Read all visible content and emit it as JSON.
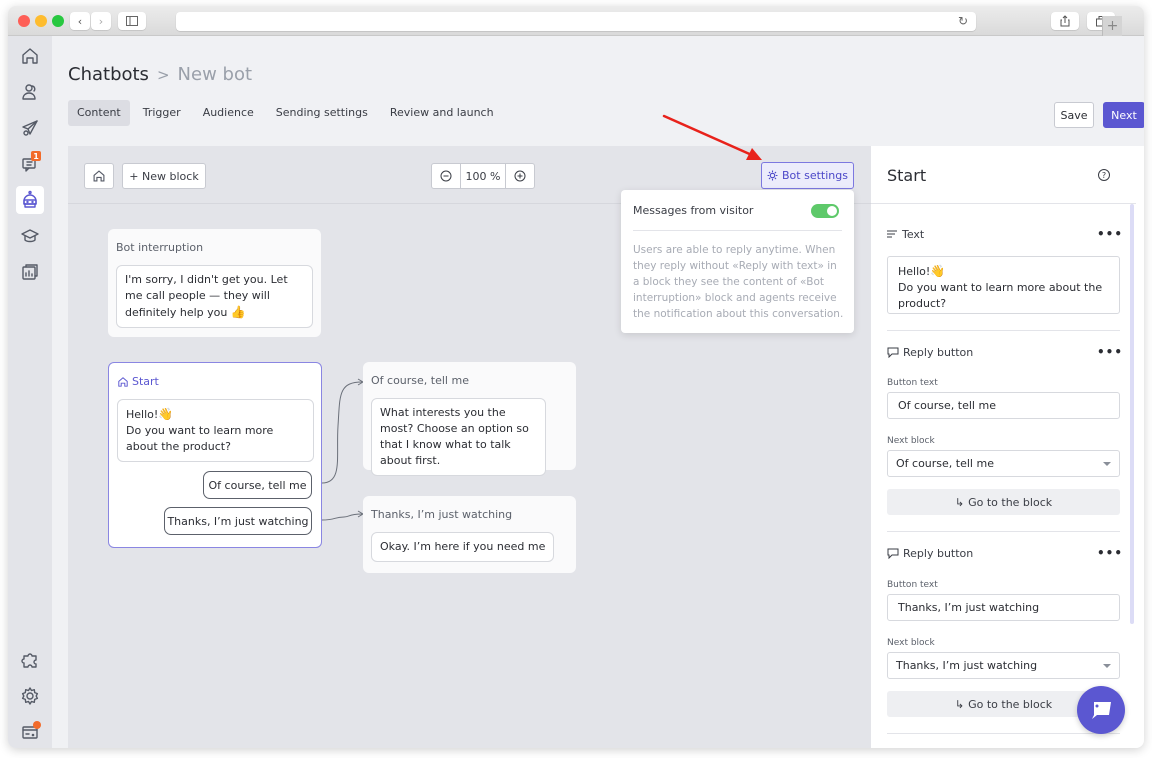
{
  "browser": {
    "back_icon": "chevron-left-icon",
    "forward_icon": "chevron-right-icon",
    "sidebar_icon": "sidebar-toggle-icon",
    "reload_icon": "reload-icon",
    "share_icon": "share-icon",
    "tabs_icon": "tabs-overview-icon",
    "new_tab_label": "+"
  },
  "sidebar": {
    "items": [
      {
        "name": "home",
        "icon": "home-icon"
      },
      {
        "name": "contacts",
        "icon": "users-icon"
      },
      {
        "name": "campaigns",
        "icon": "paper-plane-icon"
      },
      {
        "name": "conversations",
        "icon": "chat-icon",
        "badge": "1"
      },
      {
        "name": "chatbots",
        "icon": "bot-icon",
        "active": true
      },
      {
        "name": "academy",
        "icon": "graduation-cap-icon"
      },
      {
        "name": "reports",
        "icon": "report-icon"
      }
    ],
    "bottom_items": [
      {
        "name": "integrations",
        "icon": "puzzle-icon"
      },
      {
        "name": "settings",
        "icon": "gear-icon"
      },
      {
        "name": "billing",
        "icon": "billing-card-icon",
        "dot": true
      }
    ]
  },
  "header": {
    "breadcrumb_root": "Chatbots",
    "breadcrumb_sep": ">",
    "breadcrumb_current": "New bot",
    "tabs": [
      "Content",
      "Trigger",
      "Audience",
      "Sending settings",
      "Review and launch"
    ],
    "active_tab": "Content",
    "save_label": "Save",
    "next_label": "Next"
  },
  "canvas": {
    "new_block_label": "+ New block",
    "zoom_value": "100 %",
    "zoom_out_label": "−",
    "zoom_in_label": "+",
    "bot_settings_label": "Bot settings",
    "blocks": {
      "interruption": {
        "title": "Bot interruption",
        "message": "I'm sorry, I didn't get you. Let me call people — they will definitely help you",
        "emoji": "👍"
      },
      "start": {
        "title": "Start",
        "message_line1": "Hello!",
        "emoji": "👋",
        "message_line2": "Do you want to learn more about the product?",
        "replies": [
          "Of course, tell me",
          "Thanks, I’m just watching"
        ]
      },
      "tell_me": {
        "title": "Of course, tell me",
        "message": "What interests you the most? Choose an option so that I know what to talk about first."
      },
      "watching": {
        "title": "Thanks, I’m just watching",
        "message": "Okay. I’m here if you need me"
      }
    }
  },
  "bot_settings_popover": {
    "label": "Messages from visitor",
    "toggle_on": true,
    "description": "Users are able to reply anytime. When they reply without «Reply with text» in a block they see the content of «Bot interruption» block and agents receive the notification about this conversation."
  },
  "panel": {
    "title": "Start",
    "help_label": "?",
    "text_section": {
      "label": "Text",
      "more": "•••",
      "line1": "Hello!",
      "emoji": "👋",
      "line2": "Do you want to learn more about the product?"
    },
    "reply_sections": [
      {
        "label": "Reply button",
        "more": "•••",
        "button_text_label": "Button text",
        "button_text": "Of course, tell me",
        "next_block_label": "Next block",
        "next_block": "Of course, tell me",
        "goto_label": "Go to the block"
      },
      {
        "label": "Reply button",
        "more": "•••",
        "button_text_label": "Button text",
        "button_text": "Thanks, I’m just watching",
        "next_block_label": "Next block",
        "next_block": "Thanks, I’m just watching",
        "goto_label": "Go to the block"
      }
    ]
  },
  "colors": {
    "accent": "#5b57d1",
    "toggle_on": "#5ec96a",
    "badge": "#f26b2b",
    "annotation_arrow": "#e8221b"
  }
}
